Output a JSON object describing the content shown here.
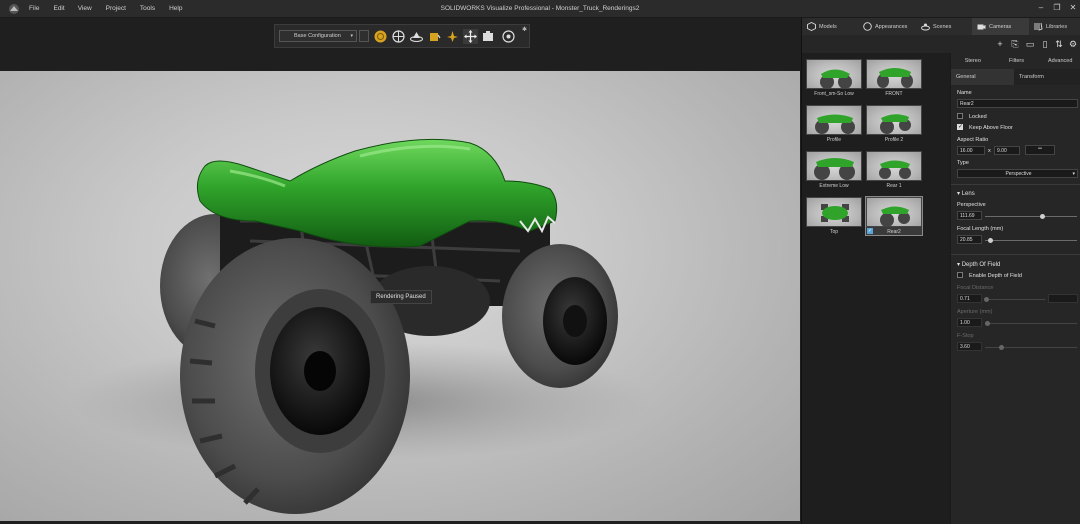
{
  "window": {
    "title": "SOLIDWORKS Visualize Professional - Monster_Truck_Renderings2",
    "menu": [
      "File",
      "Edit",
      "View",
      "Project",
      "Tools",
      "Help"
    ]
  },
  "toolbar": {
    "configuration": "Base Configuration"
  },
  "viewport": {
    "tooltip": "Rendering Paused"
  },
  "panel": {
    "tabs": [
      "Models",
      "Appearances",
      "Scenes",
      "Cameras",
      "Libraries"
    ],
    "active_tab": "Cameras",
    "cameras": [
      {
        "label": "Front_sm-So Low"
      },
      {
        "label": "FRONT"
      },
      {
        "label": "Profile"
      },
      {
        "label": "Profile 2"
      },
      {
        "label": "Extreme Low"
      },
      {
        "label": "Rear 1"
      },
      {
        "label": "Top"
      },
      {
        "label": "Rear2"
      }
    ],
    "selected_camera": "Rear2",
    "subtabs": [
      "Stereo",
      "Filters",
      "Advanced"
    ],
    "subtabs2": [
      "General",
      "Transform"
    ],
    "general": {
      "name_label": "Name",
      "name_value": "Rear2",
      "locked_label": "Locked",
      "keep_floor_label": "Keep Above Floor",
      "aspect_label": "Aspect Ratio",
      "aspect_w": "16.00",
      "aspect_h": "9.00",
      "aspect_sep": "x",
      "type_label": "Type",
      "type_value": "Perspective",
      "lens_label": "Lens",
      "perspective_label": "Perspective",
      "perspective_value": "111.69",
      "focal_label": "Focal Length (mm)",
      "focal_value": "20.85",
      "dof_label": "Depth Of Field",
      "enable_dof_label": "Enable Depth of Field",
      "focal_distance_label": "Focal Distance",
      "focal_distance_value": "0.71",
      "aperture_label": "Aperture (mm)",
      "aperture_value": "1.00",
      "fstop_label": "F-Stop",
      "fstop_value": "3.60"
    },
    "sliders": {
      "perspective": 0.62,
      "focal_length": 0.06,
      "focal_distance": 0.03,
      "aperture": 0.03,
      "fstop": 0.18
    }
  },
  "colors": {
    "accent_green": "#2fa32a",
    "panel_bg": "#262626"
  }
}
